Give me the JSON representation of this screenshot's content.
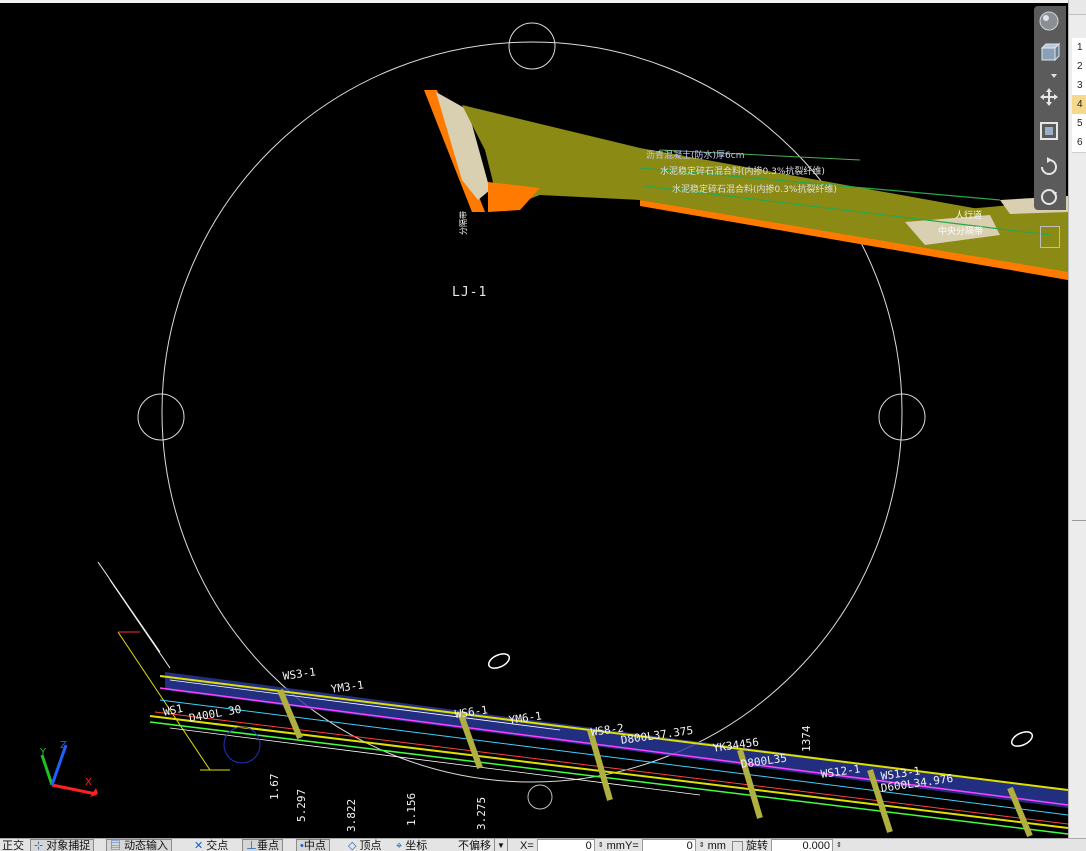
{
  "canvas": {
    "label_main": "LJ-1",
    "bottom_labels": [
      "WS1",
      "WS3-1",
      "YM3-1",
      "D400L 30",
      "WS6-1",
      "YM6-1",
      "WS8-2",
      "D800L37.375",
      "YK34456",
      "WS12-1",
      "WS13-1",
      "D600L34.976",
      "D800L35",
      "1374",
      "5.297",
      "3.822",
      "1.156",
      "1.67",
      "3.275"
    ],
    "band_notes": [
      "沥青混凝土(防水)厚6cm",
      "水泥稳定碎石混合料(内掺0.3%抗裂纤维)",
      "水泥稳定碎石混合料(内掺0.3%抗裂纤维)",
      "人行道",
      "中央分隔带"
    ]
  },
  "navbar": {
    "buttons": [
      "steering-wheel-icon",
      "view-cube-icon",
      "pan-icon",
      "zoom-extents-icon",
      "orbit-icon",
      "showmotion-icon"
    ]
  },
  "right_panel": {
    "rows": [
      "1",
      "2",
      "3",
      "4",
      "5",
      "6"
    ],
    "active_row": "4"
  },
  "statusbar": {
    "ortho": "正交",
    "osnap": "对象捕捉",
    "otrack": "动态输入",
    "intersection": "交点",
    "perpendicular": "垂点",
    "midpoint": "中点",
    "vertex": "顶点",
    "coordinate": "坐标",
    "offset_mode": "不偏移",
    "x_label": "X=",
    "x_value": "0",
    "x_unit": "mm",
    "y_label": "Y=",
    "y_value": "0",
    "y_unit": "mm",
    "rotate_label": "旋转",
    "rotate_value": "0.000"
  },
  "colors": {
    "background": "#000000",
    "band_olive": "#8a8a14",
    "band_orange": "#ff7a00",
    "band_beige": "#d8d0b0",
    "circle": "#dcdcdc"
  }
}
